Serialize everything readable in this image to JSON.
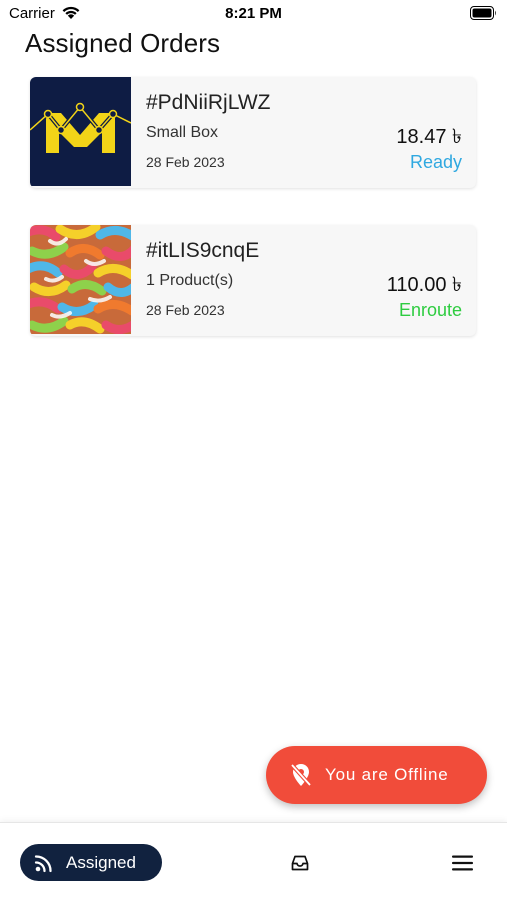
{
  "status_bar": {
    "carrier": "Carrier",
    "time": "8:21 PM"
  },
  "header": {
    "title": "Assigned Orders"
  },
  "orders": [
    {
      "id": "#PdNiiRjLWZ",
      "description": "Small Box",
      "date": "28 Feb 2023",
      "price": "18.47 ৳",
      "status": "Ready",
      "status_color": "#2fa8e0",
      "thumbnail": "logo-m-icon"
    },
    {
      "id": "#itLIS9cnqE",
      "description": "1 Product(s)",
      "date": "28 Feb 2023",
      "price": "110.00 ৳",
      "status": "Enroute",
      "status_color": "#2ecc40",
      "thumbnail": "gummy-candy-image"
    }
  ],
  "offline_button": {
    "label": "You are Offline",
    "icon": "location-off-icon",
    "color": "#f14c3a"
  },
  "bottom_nav": {
    "assigned_label": "Assigned",
    "assigned_icon": "rss-feed-icon",
    "orders_icon": "inbox-icon",
    "menu_icon": "hamburger-menu-icon",
    "active_color": "#11223f"
  }
}
